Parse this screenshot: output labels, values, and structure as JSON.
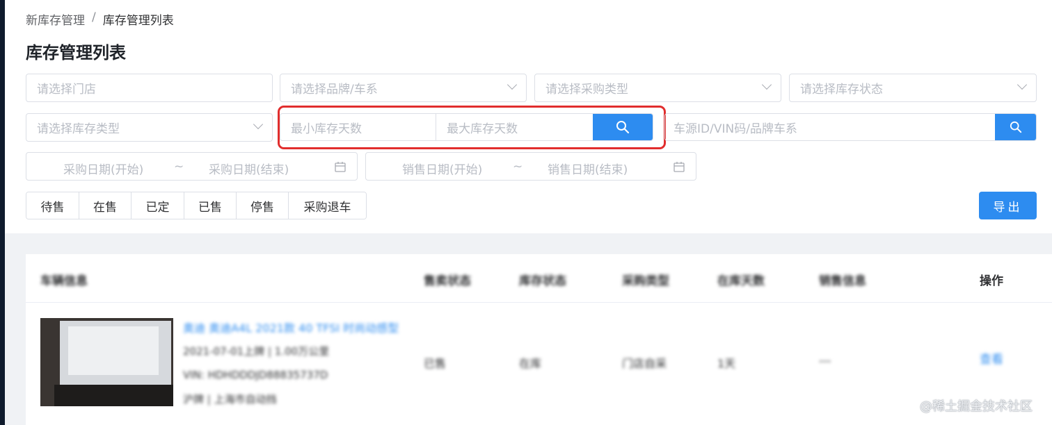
{
  "breadcrumb": {
    "root": "新库存管理",
    "separator": "/",
    "current": "库存管理列表"
  },
  "page_title": "库存管理列表",
  "filters": {
    "store": "请选择门店",
    "brand": "请选择品牌/车系",
    "purchase_type": "请选择采购类型",
    "stock_status": "请选择库存状态",
    "stock_type": "请选择库存类型",
    "min_days": "最小库存天数",
    "max_days": "最大库存天数",
    "keyword": "车源ID/VIN码/品牌车系",
    "purchase_date_start": "采购日期(开始)",
    "purchase_date_end": "采购日期(结束)",
    "sales_date_start": "销售日期(开始)",
    "sales_date_end": "销售日期(结束)",
    "range_sep": "~"
  },
  "status_tabs": [
    "待售",
    "在售",
    "已定",
    "已售",
    "停售",
    "采购退车"
  ],
  "export_label": "导出",
  "table": {
    "headers": [
      "车辆信息",
      "售卖状态",
      "库存状态",
      "采购类型",
      "在库天数",
      "销售信息",
      "操作"
    ],
    "row": {
      "title": "奥迪 奥迪A4L 2021款 40 TFSI 时尚动感型",
      "line1": "2021-07-01上牌 | 1.00万公里",
      "line2": "VIN: HDHDDDJD88835737D",
      "line3": "沪牌 | 上海市自动挡",
      "sale_status": "已售",
      "stock_status": "在库",
      "purchase_type": "门店自采",
      "days": "1天",
      "sales_info": "---",
      "action": "查看"
    }
  },
  "watermark": "@稀土掘金技术社区",
  "colors": {
    "primary": "#2d8cf0",
    "highlight": "#e12d2d"
  }
}
